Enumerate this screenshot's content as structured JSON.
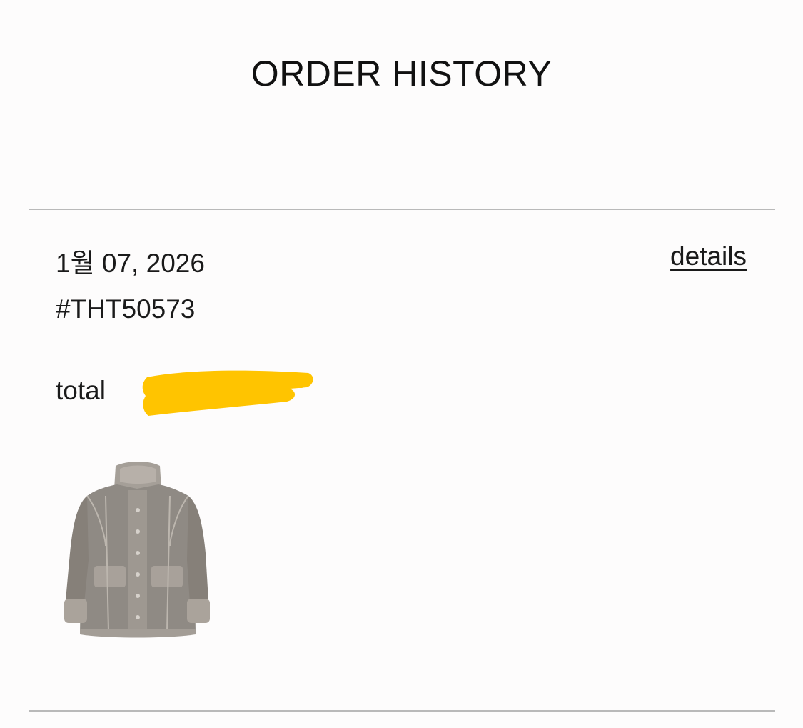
{
  "header": {
    "title": "ORDER HISTORY"
  },
  "order": {
    "date": "1월 07, 2026",
    "details_label": "details",
    "order_number": "#THT50573",
    "total_label": "total",
    "total_value_redacted": true,
    "redaction_color": "#FFC400",
    "items": [
      {
        "image_icon": "shearling-jacket-image",
        "color": "#8f8a84"
      }
    ]
  },
  "colors": {
    "background": "#fdfcfc",
    "divider": "#b9b9b9",
    "text": "#1a1a1a"
  }
}
